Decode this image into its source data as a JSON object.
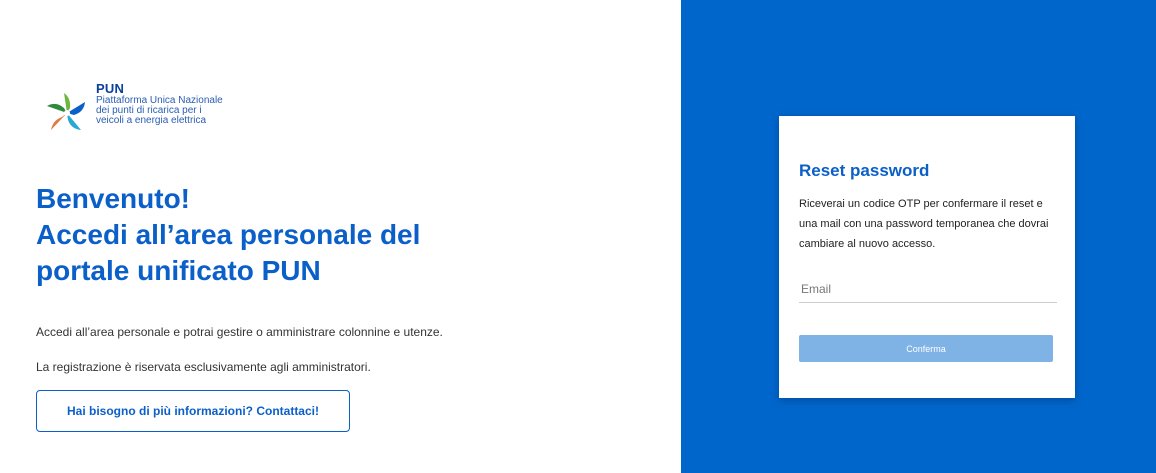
{
  "logo": {
    "title": "PUN",
    "subtitle_lines": [
      "Piattaforma Unica Nazionale",
      "dei punti di ricarica per i",
      "veicoli a energia elettrica"
    ]
  },
  "welcome": {
    "lines": [
      "Benvenuto!",
      "Accedi all’area personale del",
      "portale unificato PUN"
    ],
    "desc1": "Accedi all’area personale e potrai gestire o amministrare colonnine e utenze.",
    "desc2": "La registrazione è riservata esclusivamente agli amministratori.",
    "contact_label": "Hai bisogno di più informazioni? Contattaci!"
  },
  "reset": {
    "title": "Reset password",
    "description": "Riceverai un codice OTP per confermare il reset e una mail con una password temporanea che dovrai cambiare al nuovo accesso.",
    "email_placeholder": "Email",
    "email_value": "",
    "confirm_label": "Conferma"
  },
  "colors": {
    "brand_blue": "#0066cc",
    "headline_blue": "#0b5fc9",
    "button_disabled": "#7fb2e5"
  },
  "icons": {
    "logo": "star-logo-icon"
  }
}
